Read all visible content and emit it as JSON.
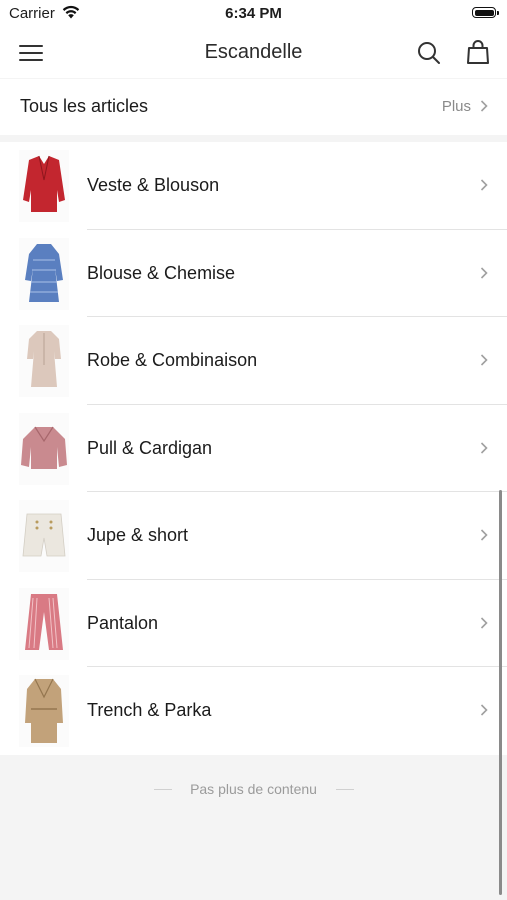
{
  "status_bar": {
    "carrier": "Carrier",
    "time": "6:34 PM"
  },
  "nav": {
    "title": "Escandelle",
    "icons": [
      "hamburger-menu-icon",
      "search-icon",
      "shopping-bag-icon"
    ]
  },
  "all_articles": {
    "label": "Tous les articles",
    "more_label": "Plus"
  },
  "categories": [
    {
      "name": "Veste & Blouson",
      "thumb": "red-leather-jacket",
      "color": "#c3262f"
    },
    {
      "name": "Blouse &  Chemise",
      "thumb": "blue-striped-dress",
      "color": "#5a7fc0"
    },
    {
      "name": "Robe & Combinaison",
      "thumb": "beige-dress",
      "color": "#d9c4b8"
    },
    {
      "name": "Pull & Cardigan",
      "thumb": "pink-sweater",
      "color": "#c98a8f"
    },
    {
      "name": "Jupe & short",
      "thumb": "white-shorts",
      "color": "#e8e4dc"
    },
    {
      "name": "Pantalon",
      "thumb": "pink-striped-pants",
      "color": "#d97a84"
    },
    {
      "name": "Trench & Parka",
      "thumb": "beige-trench-coat",
      "color": "#c2a27a"
    }
  ],
  "footer": {
    "text": "Pas plus de contenu"
  }
}
